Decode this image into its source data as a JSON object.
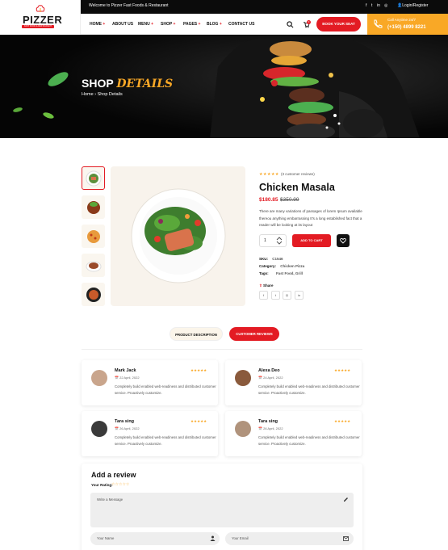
{
  "brand": {
    "name": "PIZZER",
    "tagline": "FAST FOOD & RESTAURANT"
  },
  "topbar": {
    "welcome": "Welcome to Pizzer Fast Foods & Restaurant",
    "social": [
      "f",
      "t",
      "in",
      "◎"
    ],
    "login": "Login/Register"
  },
  "nav": {
    "items": [
      {
        "label": "HOME",
        "plus": true
      },
      {
        "label": "ABOUT US",
        "plus": false
      },
      {
        "label": "MENU",
        "plus": true
      },
      {
        "label": "SHOP",
        "plus": true
      },
      {
        "label": "PAGES",
        "plus": true
      },
      {
        "label": "BLOG",
        "plus": true
      },
      {
        "label": "CONTACT US",
        "plus": false
      }
    ],
    "cart_count": "0",
    "book_label": "BOOK YOUR SEAT"
  },
  "call": {
    "label": "Call Anytime 24/7",
    "number": "(+150) 4899 8221"
  },
  "hero": {
    "title_a": "SHOP",
    "title_b": "DETAILS",
    "crumb_home": "Home",
    "crumb_current": "Shop Details"
  },
  "product": {
    "stars": "★★★★★",
    "review_count": "(3 customer reviews)",
    "name": "Chicken Masala",
    "price": "$180.85",
    "old_price": "$350.99",
    "description": "There are many variations of passages of lorem Ipsum available thereou anything embarrassing It's a long established fact that a reader will be looking at its layout",
    "qty": "1",
    "add_to_cart": "ADD TO CART",
    "sku_label": "SKU:",
    "sku": "C1546",
    "cat_label": "Category:",
    "category": "Chicken Pizza",
    "tags_label": "Tags:",
    "tags": "Fast Food, Grill",
    "share_label": "Share",
    "share_icons": [
      "f",
      "t",
      "◎",
      "in"
    ]
  },
  "tabs": {
    "description": "PRODUCT DESCRIPTION",
    "reviews": "CUSTOMER REVIEWS"
  },
  "reviews": [
    {
      "name": "Mark Jack",
      "date": "22 April, 2022",
      "stars": "★★★★★",
      "text": "Completely build enabled web-readiness and distributed customer service. Proactively customize."
    },
    {
      "name": "Alexa Deo",
      "date": "24 April, 2022",
      "stars": "★★★★★",
      "text": "Completely build enabled web-readiness and distributed customer service. Proactively customize."
    },
    {
      "name": "Tara sing",
      "date": "26 April, 2022",
      "stars": "★★★★★",
      "text": "Completely build enabled web-readiness and distributed customer service. Proactively customize."
    },
    {
      "name": "Tara sing",
      "date": "26 April, 2022",
      "stars": "★★★★★",
      "text": "Completely build enabled web-readiness and distributed customer service. Proactively customize."
    }
  ],
  "add_review": {
    "title": "Add a review",
    "rating_label": "Your Rating:",
    "rating_stars": "☆☆☆☆☆",
    "message_ph": "Write a Message",
    "name_ph": "Your Name",
    "email_ph": "Your Email"
  },
  "colors": {
    "accent": "#e31b23",
    "secondary": "#f9a826",
    "dark": "#0b0b0b"
  }
}
